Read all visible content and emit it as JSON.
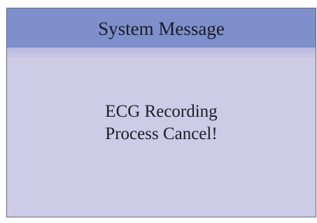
{
  "dialog": {
    "title": "System Message",
    "message_lines": [
      "ECG Recording",
      "Process Cancel!"
    ]
  },
  "colors": {
    "title_bar": "#7e8fcb",
    "body": "#cdcbe6",
    "text": "#1c1c24"
  }
}
